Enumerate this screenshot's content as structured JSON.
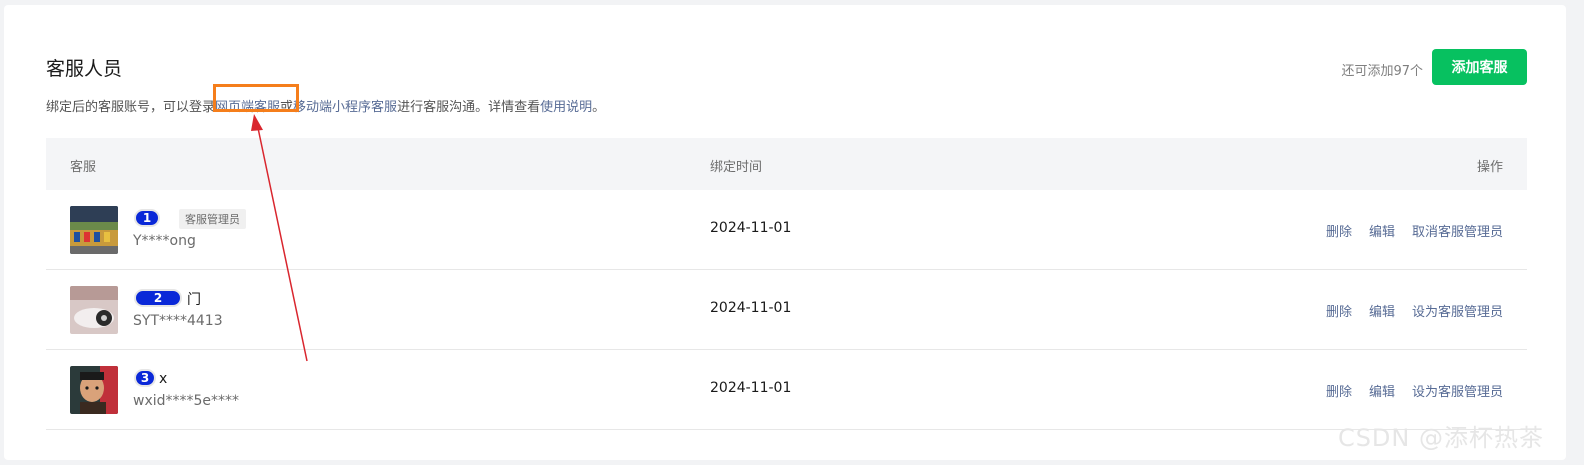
{
  "section": {
    "title": "客服人员",
    "desc_prefix": "绑定后的客服账号，可以登录",
    "desc_link_web": "网页端客服",
    "desc_or": "或",
    "desc_link_mini": "移动端小程序客服",
    "desc_mid": "进行客服沟通。详情查看",
    "desc_link_help": "使用说明",
    "desc_end": "。"
  },
  "header_right": {
    "remaining": "还可添加97个",
    "add_label": "添加客服"
  },
  "table": {
    "columns": [
      "客服",
      "绑定时间",
      "操作"
    ],
    "rows": [
      {
        "badge": "1",
        "name": "",
        "role": "客服管理员",
        "account": "Y****ong",
        "time": "2024-11-01",
        "actions": [
          "删除",
          "编辑",
          "取消客服管理员"
        ]
      },
      {
        "badge": "2",
        "name": "门",
        "role": "",
        "account": "SYT****4413",
        "time": "2024-11-01",
        "actions": [
          "删除",
          "编辑",
          "设为客服管理员"
        ]
      },
      {
        "badge": "3",
        "name": "x",
        "role": "",
        "account": "wxid****5e****",
        "time": "2024-11-01",
        "actions": [
          "删除",
          "编辑",
          "设为客服管理员"
        ]
      }
    ]
  },
  "watermark": "CSDN @添杯热茶",
  "colors": {
    "accent_green": "#07c160",
    "link_blue": "#576b95",
    "annotation_orange": "#f57e1b",
    "annotation_red": "#d9262e"
  }
}
